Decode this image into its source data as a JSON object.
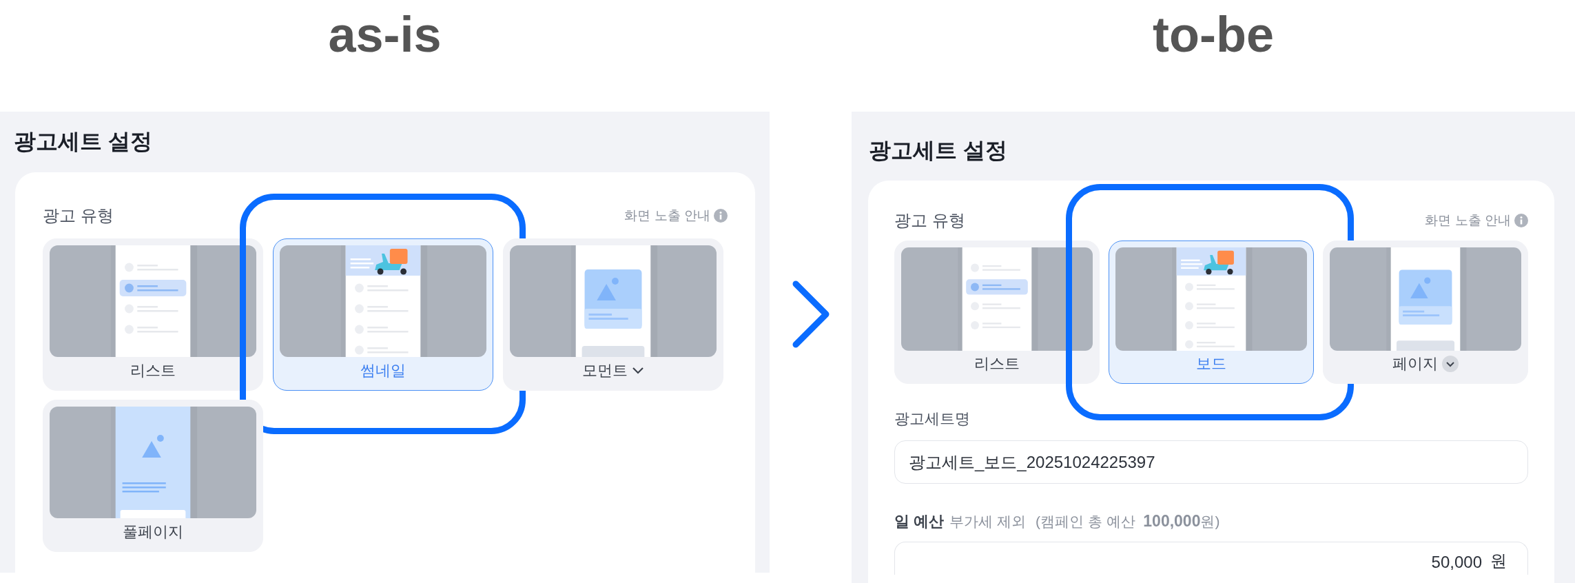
{
  "panels": [
    {
      "heading": "as-is",
      "title": "광고세트 설정",
      "section_label": "광고 유형",
      "guide_link": "화면 노출 안내",
      "options": [
        {
          "label": "리스트",
          "kind": "list",
          "selected": false,
          "highlighted": false
        },
        {
          "label": "썸네일",
          "kind": "thumbnail",
          "selected": true,
          "highlighted": true
        },
        {
          "label": "모먼트",
          "kind": "moment",
          "selected": false,
          "highlighted": false,
          "dropdown": {
            "kind": "chevron"
          }
        },
        {
          "label": "풀페이지",
          "kind": "fullpage",
          "selected": false,
          "highlighted": false
        }
      ]
    },
    {
      "heading": "to-be",
      "title": "광고세트 설정",
      "section_label": "광고 유형",
      "guide_link": "화면 노출 안내",
      "options": [
        {
          "label": "리스트",
          "kind": "list",
          "selected": false,
          "highlighted": false
        },
        {
          "label": "보드",
          "kind": "thumbnail",
          "selected": true,
          "highlighted": true
        },
        {
          "label": "페이지",
          "kind": "moment",
          "selected": false,
          "highlighted": false,
          "dropdown": {
            "kind": "circle"
          }
        }
      ],
      "fields": [
        {
          "kind": "text",
          "label": "광고세트명",
          "value": "광고세트_보드_20251024225397"
        },
        {
          "kind": "amount",
          "label": "일 예산",
          "note": "부가세 제외",
          "hint": "(캠페인 총 예산  **100,000**원)",
          "value": "50,000",
          "unit": "원"
        }
      ]
    }
  ]
}
